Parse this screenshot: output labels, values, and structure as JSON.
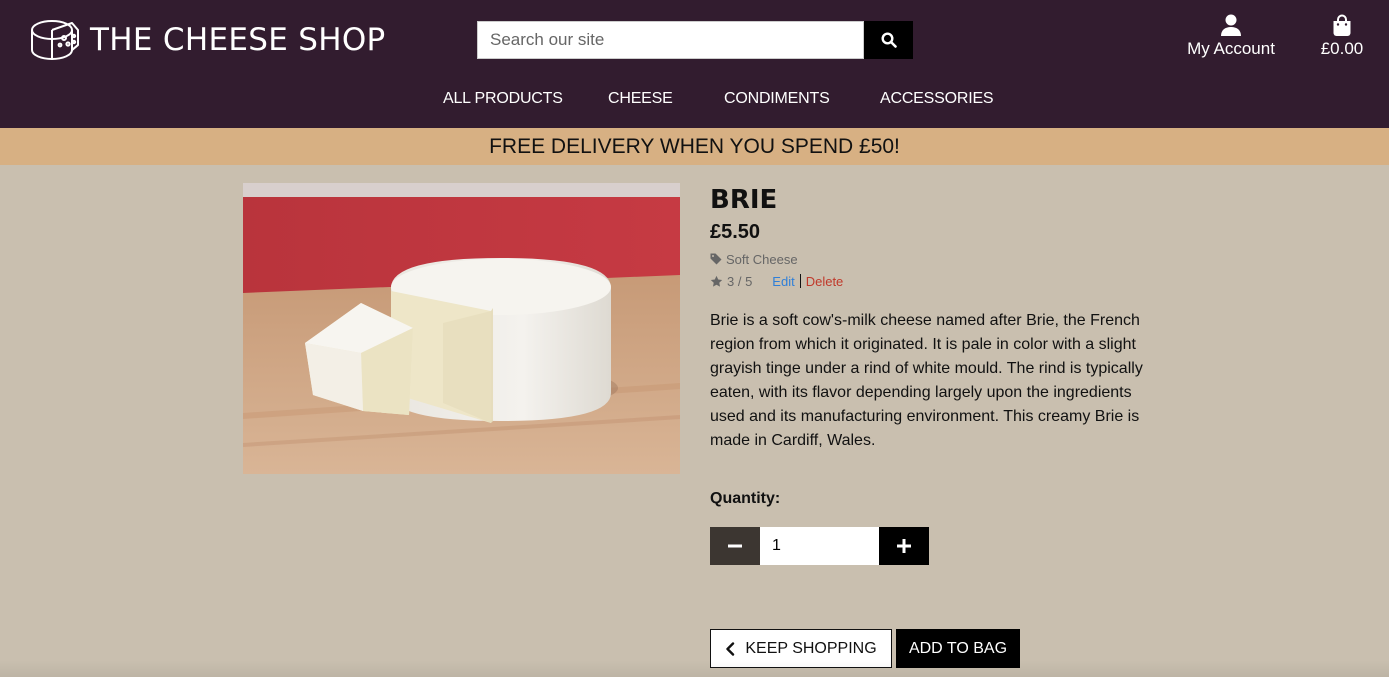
{
  "header": {
    "logo_text": "THE CHEESE SHOP",
    "search_placeholder": "Search our site",
    "account_label": "My Account",
    "bag_total": "£0.00"
  },
  "nav": {
    "items": [
      {
        "label": "ALL PRODUCTS"
      },
      {
        "label": "CHEESE"
      },
      {
        "label": "CONDIMENTS"
      },
      {
        "label": "ACCESSORIES"
      }
    ]
  },
  "banner": {
    "text": "FREE DELIVERY WHEN YOU SPEND £50!"
  },
  "product": {
    "name": "BRIE",
    "price": "£5.50",
    "category": "Soft Cheese",
    "rating": "3 / 5",
    "edit_label": "Edit",
    "delete_label": "Delete",
    "description": "Brie is a soft cow's-milk cheese named after Brie, the French region from which it originated. It is pale in color with a slight grayish tinge under a rind of white mould. The rind is typically eaten, with its flavor depending largely upon the ingredients used and its manufacturing environment. This creamy Brie is made in Cardiff, Wales."
  },
  "quantity": {
    "label": "Quantity:",
    "value": "1"
  },
  "actions": {
    "keep_shopping": "KEEP SHOPPING",
    "add_to_bag": "ADD TO BAG"
  },
  "colors": {
    "header_bg": "#321c2f",
    "banner_bg": "#d7b083",
    "page_bg": "#c9bfaf",
    "edit_link": "#2f7fd8",
    "delete_link": "#c0392b"
  },
  "icons": [
    "cheese-logo-icon",
    "search-icon",
    "user-icon",
    "shopping-bag-icon",
    "tag-icon",
    "star-icon",
    "minus-icon",
    "plus-icon",
    "chevron-left-icon"
  ]
}
